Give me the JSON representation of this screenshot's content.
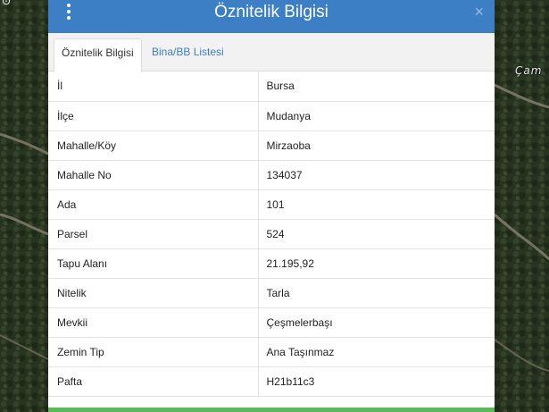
{
  "map": {
    "place_label": "Çam"
  },
  "modal": {
    "title": "Öznitelik Bilgisi",
    "close_symbol": "×",
    "menu_icon": "vertical-dots-icon",
    "close_icon": "close-icon"
  },
  "tabs": [
    {
      "label": "Öznitelik Bilgisi",
      "active": true
    },
    {
      "label": "Bina/BB Listesi",
      "active": false
    }
  ],
  "attributes": [
    {
      "key": "İl",
      "value": "Bursa"
    },
    {
      "key": "İlçe",
      "value": "Mudanya"
    },
    {
      "key": "Mahalle/Köy",
      "value": "Mirzaoba"
    },
    {
      "key": "Mahalle No",
      "value": "134037"
    },
    {
      "key": "Ada",
      "value": "101"
    },
    {
      "key": "Parsel",
      "value": "524"
    },
    {
      "key": "Tapu Alanı",
      "value": "21.195,92"
    },
    {
      "key": "Nitelik",
      "value": "Tarla"
    },
    {
      "key": "Mevkii",
      "value": "Çeşmelerbaşı"
    },
    {
      "key": "Zemin Tip",
      "value": "Ana Taşınmaz"
    },
    {
      "key": "Pafta",
      "value": "H21b11c3"
    }
  ],
  "colors": {
    "header": "#3d7fc4",
    "link": "#3d7fc4",
    "footer": "#5cb85c"
  }
}
